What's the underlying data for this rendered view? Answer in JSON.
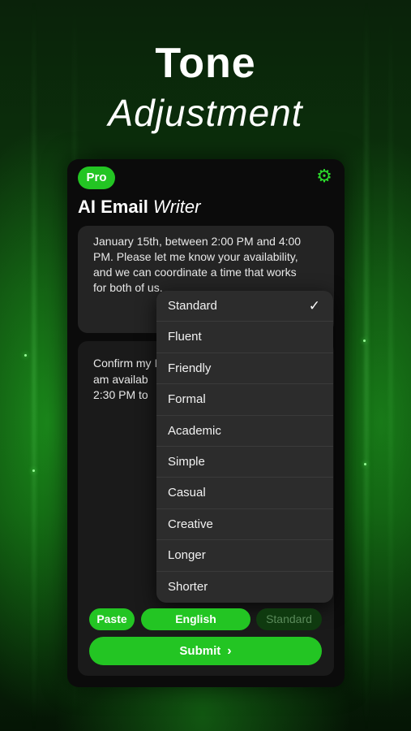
{
  "promo": {
    "title_line1": "Tone",
    "title_line2": "Adjustment"
  },
  "header": {
    "badge": "Pro",
    "title_bold": "AI Email",
    "title_italic": "Writer",
    "settings_icon": "gear-icon"
  },
  "input_text": "January 15th, between 2:00 PM and 4:00 PM. Please let me know your availability, and we can coordinate a time that works for both of us.",
  "output_text": "Confirm my I am availab 2:30 PM to",
  "tone_menu": {
    "selected": "Standard",
    "options": [
      "Standard",
      "Fluent",
      "Friendly",
      "Formal",
      "Academic",
      "Simple",
      "Casual",
      "Creative",
      "Longer",
      "Shorter"
    ]
  },
  "controls": {
    "paste": "Paste",
    "language": "English",
    "tone": "Standard",
    "submit": "Submit"
  },
  "colors": {
    "accent": "#23c523",
    "panel": "#0b0b0b",
    "menu": "#2c2c2c"
  }
}
